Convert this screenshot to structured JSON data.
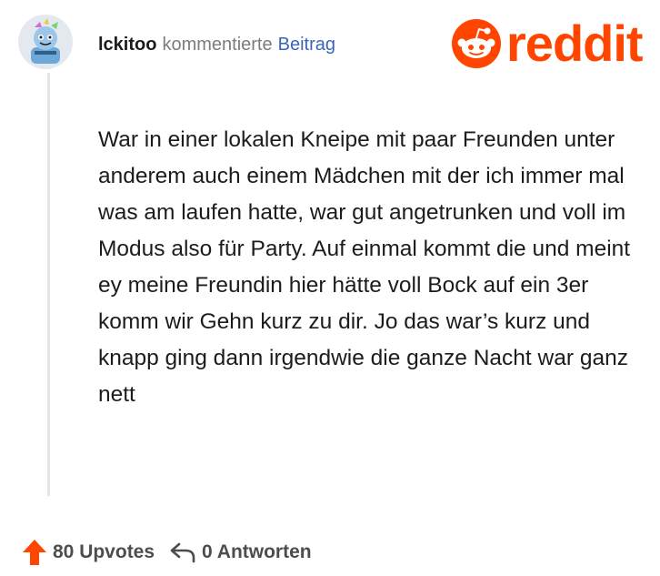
{
  "comment": {
    "username": "lckitoo",
    "action_text": "kommentierte",
    "post_link_text": "Beitrag",
    "body": "War in einer lokalen Kneipe mit paar Freunden unter anderem auch einem Mädchen mit der ich immer mal was am laufen hatte, war gut angetrunken und voll im Modus also für Party. Auf einmal kommt die und meint ey meine Freundin hier hätte voll Bock auf ein 3er komm wir Gehn kurz zu dir. Jo das war’s kurz und knapp ging dann irgendwie die ganze Nacht war ganz nett"
  },
  "brand": {
    "wordmark": "reddit",
    "color": "#ff4500"
  },
  "footer": {
    "upvotes_label": "80 Upvotes",
    "replies_label": "0 Antworten"
  },
  "icons": {
    "upvote": "upvote-arrow-icon",
    "reply": "reply-arrow-icon",
    "brand": "reddit-snoo-icon",
    "avatar": "user-avatar"
  },
  "colors": {
    "link": "#3a66b8",
    "upvote": "#ff4500",
    "meta": "#7c7c7c",
    "text": "#1c1c1c"
  }
}
